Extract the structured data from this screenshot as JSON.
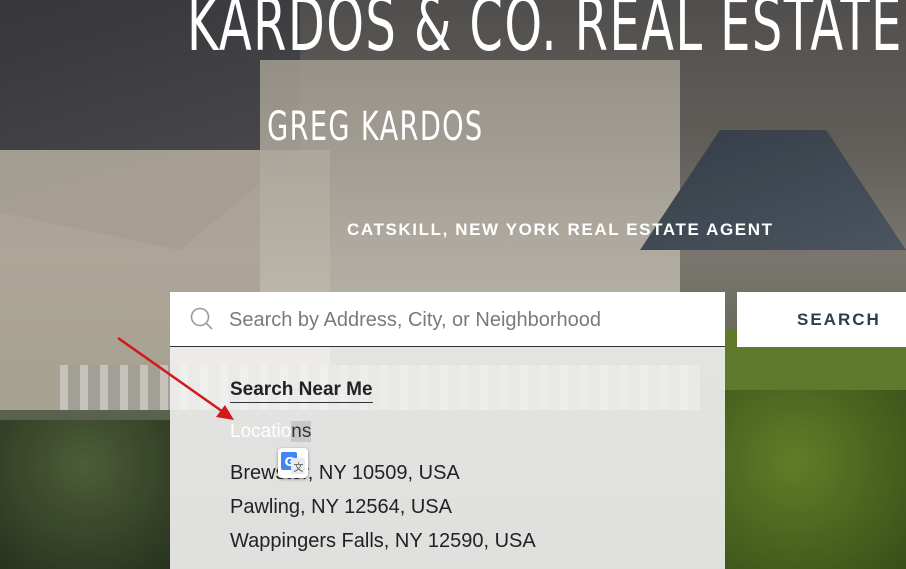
{
  "brand": {
    "title": "KARDOS & CO. REAL ESTATE"
  },
  "agent": {
    "name": "GREG KARDOS",
    "title": "CATSKILL, NEW YORK REAL ESTATE AGENT"
  },
  "search": {
    "placeholder": "Search by Address, City, or Neighborhood",
    "value": "",
    "button_label": "SEARCH"
  },
  "dropdown": {
    "near_me_label": "Search Near Me",
    "locations_heading_visible": "Locatio",
    "locations_heading_highlight": "ns",
    "locations": [
      "Brewster, NY 10509, USA",
      "Pawling, NY 12564, USA",
      "Wappingers Falls, NY 12590, USA"
    ]
  },
  "colors": {
    "accent": "#2c3e50",
    "arrow": "#d11a1a"
  },
  "icons": [
    "search-icon",
    "google-translate-icon",
    "annotation-arrow"
  ]
}
